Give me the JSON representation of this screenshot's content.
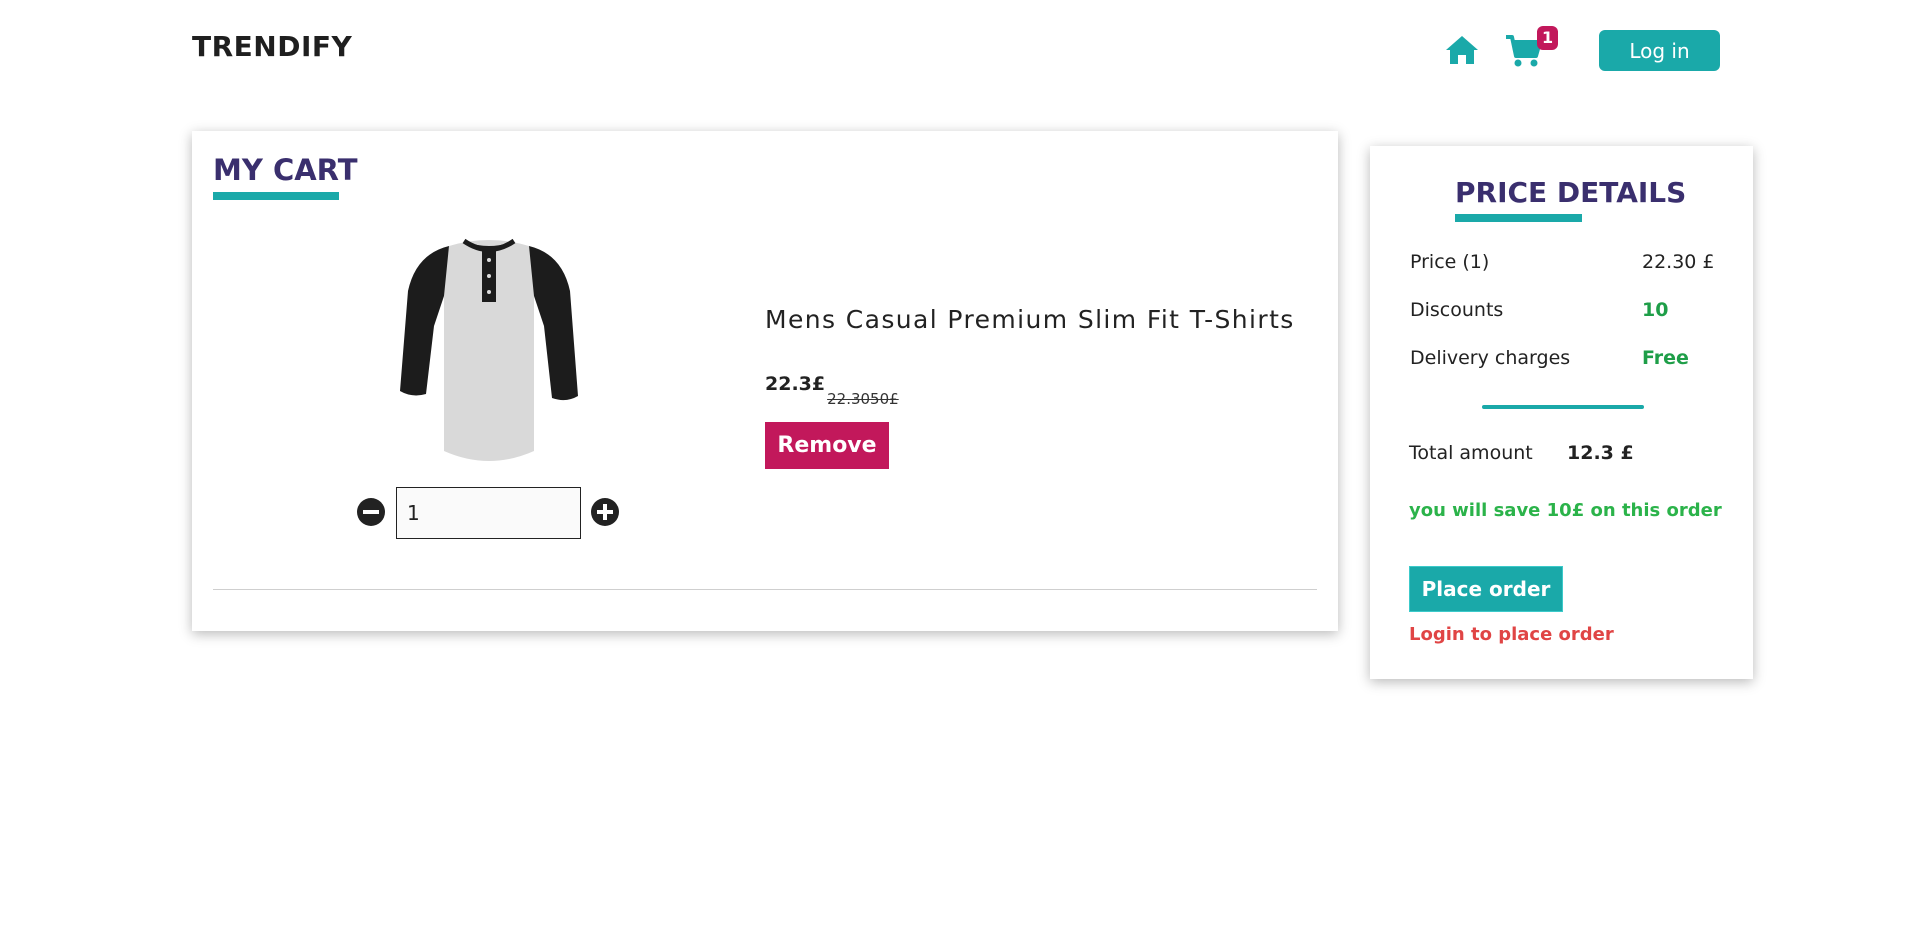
{
  "header": {
    "brand": "TRENDIFY",
    "cart_count": "1",
    "login_label": "Log in"
  },
  "cart": {
    "title": "MY CART",
    "item": {
      "name": "Mens Casual Premium Slim Fit T-Shirts",
      "price": "22.3£",
      "original_price": "22.3050£",
      "quantity": "1",
      "remove_label": "Remove",
      "image": "raglan-henley-shirt"
    }
  },
  "price_details": {
    "title": "PRICE DETAILS",
    "rows": [
      {
        "label": "Price (1)",
        "value": "22.30 £"
      },
      {
        "label": "Discounts",
        "value": "10"
      },
      {
        "label": "Delivery charges",
        "value": "Free"
      }
    ],
    "total_label": "Total amount",
    "total_value": "12.3 £",
    "savings_text": "you will save 10£ on this order",
    "place_order_label": "Place order",
    "login_warning": "Login to place order"
  },
  "colors": {
    "accent": "#1aa9a9",
    "title": "#3a2f6e",
    "remove": "#c2185b",
    "green": "#1e9e48",
    "warning": "#e04545"
  },
  "icons": [
    "home-icon",
    "cart-icon",
    "minus-circle-icon",
    "plus-circle-icon"
  ]
}
